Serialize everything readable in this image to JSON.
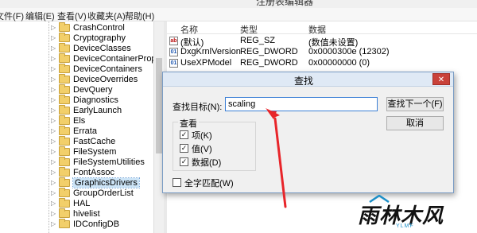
{
  "window": {
    "title": "注册表编辑器"
  },
  "menu": [
    "文件(F)",
    "编辑(E)",
    "查看(V)",
    "收藏夹(A)",
    "帮助(H)"
  ],
  "tree": {
    "items": [
      "CrashControl",
      "Cryptography",
      "DeviceClasses",
      "DeviceContainerPropert",
      "DeviceContainers",
      "DeviceOverrides",
      "DevQuery",
      "Diagnostics",
      "EarlyLaunch",
      "Els",
      "Errata",
      "FastCache",
      "FileSystem",
      "FileSystemUtilities",
      "FontAssoc",
      "GraphicsDrivers",
      "GroupOrderList",
      "HAL",
      "hivelist",
      "IDConfigDB"
    ],
    "selected": "GraphicsDrivers"
  },
  "values": {
    "headers": {
      "name": "名称",
      "type": "类型",
      "data": "数据"
    },
    "rows": [
      {
        "icon": "string-value-icon",
        "name": "(默认)",
        "type": "REG_SZ",
        "data": "(数值未设置)"
      },
      {
        "icon": "dword-value-icon",
        "name": "DxgKrnlVersion",
        "type": "REG_DWORD",
        "data": "0x0000300e (12302)"
      },
      {
        "icon": "dword-value-icon",
        "name": "UseXPModel",
        "type": "REG_DWORD",
        "data": "0x00000000 (0)"
      }
    ]
  },
  "find_dialog": {
    "title": "查找",
    "close_glyph": "✕",
    "target_label": "查找目标(N):",
    "target_value": "scaling",
    "find_next_button": "查找下一个(F)",
    "cancel_button": "取消",
    "look_at": {
      "legend": "查看",
      "options": [
        {
          "label": "项(K)",
          "checked": true
        },
        {
          "label": "值(V)",
          "checked": true
        },
        {
          "label": "数据(D)",
          "checked": true
        }
      ]
    },
    "match_whole": {
      "label": "全字匹配(W)",
      "checked": false
    }
  },
  "watermark": {
    "text": "雨林木风",
    "sub": "YLMF"
  },
  "colors": {
    "arrow": "#e8252a",
    "dialog_border": "#7a9cc4",
    "selection": "#cce4f7"
  }
}
